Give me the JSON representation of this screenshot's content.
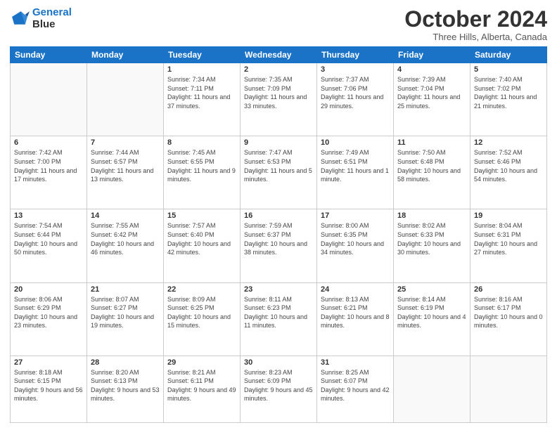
{
  "logo": {
    "line1": "General",
    "line2": "Blue"
  },
  "title": "October 2024",
  "location": "Three Hills, Alberta, Canada",
  "weekdays": [
    "Sunday",
    "Monday",
    "Tuesday",
    "Wednesday",
    "Thursday",
    "Friday",
    "Saturday"
  ],
  "weeks": [
    [
      {
        "day": "",
        "info": ""
      },
      {
        "day": "",
        "info": ""
      },
      {
        "day": "1",
        "info": "Sunrise: 7:34 AM\nSunset: 7:11 PM\nDaylight: 11 hours and 37 minutes."
      },
      {
        "day": "2",
        "info": "Sunrise: 7:35 AM\nSunset: 7:09 PM\nDaylight: 11 hours and 33 minutes."
      },
      {
        "day": "3",
        "info": "Sunrise: 7:37 AM\nSunset: 7:06 PM\nDaylight: 11 hours and 29 minutes."
      },
      {
        "day": "4",
        "info": "Sunrise: 7:39 AM\nSunset: 7:04 PM\nDaylight: 11 hours and 25 minutes."
      },
      {
        "day": "5",
        "info": "Sunrise: 7:40 AM\nSunset: 7:02 PM\nDaylight: 11 hours and 21 minutes."
      }
    ],
    [
      {
        "day": "6",
        "info": "Sunrise: 7:42 AM\nSunset: 7:00 PM\nDaylight: 11 hours and 17 minutes."
      },
      {
        "day": "7",
        "info": "Sunrise: 7:44 AM\nSunset: 6:57 PM\nDaylight: 11 hours and 13 minutes."
      },
      {
        "day": "8",
        "info": "Sunrise: 7:45 AM\nSunset: 6:55 PM\nDaylight: 11 hours and 9 minutes."
      },
      {
        "day": "9",
        "info": "Sunrise: 7:47 AM\nSunset: 6:53 PM\nDaylight: 11 hours and 5 minutes."
      },
      {
        "day": "10",
        "info": "Sunrise: 7:49 AM\nSunset: 6:51 PM\nDaylight: 11 hours and 1 minute."
      },
      {
        "day": "11",
        "info": "Sunrise: 7:50 AM\nSunset: 6:48 PM\nDaylight: 10 hours and 58 minutes."
      },
      {
        "day": "12",
        "info": "Sunrise: 7:52 AM\nSunset: 6:46 PM\nDaylight: 10 hours and 54 minutes."
      }
    ],
    [
      {
        "day": "13",
        "info": "Sunrise: 7:54 AM\nSunset: 6:44 PM\nDaylight: 10 hours and 50 minutes."
      },
      {
        "day": "14",
        "info": "Sunrise: 7:55 AM\nSunset: 6:42 PM\nDaylight: 10 hours and 46 minutes."
      },
      {
        "day": "15",
        "info": "Sunrise: 7:57 AM\nSunset: 6:40 PM\nDaylight: 10 hours and 42 minutes."
      },
      {
        "day": "16",
        "info": "Sunrise: 7:59 AM\nSunset: 6:37 PM\nDaylight: 10 hours and 38 minutes."
      },
      {
        "day": "17",
        "info": "Sunrise: 8:00 AM\nSunset: 6:35 PM\nDaylight: 10 hours and 34 minutes."
      },
      {
        "day": "18",
        "info": "Sunrise: 8:02 AM\nSunset: 6:33 PM\nDaylight: 10 hours and 30 minutes."
      },
      {
        "day": "19",
        "info": "Sunrise: 8:04 AM\nSunset: 6:31 PM\nDaylight: 10 hours and 27 minutes."
      }
    ],
    [
      {
        "day": "20",
        "info": "Sunrise: 8:06 AM\nSunset: 6:29 PM\nDaylight: 10 hours and 23 minutes."
      },
      {
        "day": "21",
        "info": "Sunrise: 8:07 AM\nSunset: 6:27 PM\nDaylight: 10 hours and 19 minutes."
      },
      {
        "day": "22",
        "info": "Sunrise: 8:09 AM\nSunset: 6:25 PM\nDaylight: 10 hours and 15 minutes."
      },
      {
        "day": "23",
        "info": "Sunrise: 8:11 AM\nSunset: 6:23 PM\nDaylight: 10 hours and 11 minutes."
      },
      {
        "day": "24",
        "info": "Sunrise: 8:13 AM\nSunset: 6:21 PM\nDaylight: 10 hours and 8 minutes."
      },
      {
        "day": "25",
        "info": "Sunrise: 8:14 AM\nSunset: 6:19 PM\nDaylight: 10 hours and 4 minutes."
      },
      {
        "day": "26",
        "info": "Sunrise: 8:16 AM\nSunset: 6:17 PM\nDaylight: 10 hours and 0 minutes."
      }
    ],
    [
      {
        "day": "27",
        "info": "Sunrise: 8:18 AM\nSunset: 6:15 PM\nDaylight: 9 hours and 56 minutes."
      },
      {
        "day": "28",
        "info": "Sunrise: 8:20 AM\nSunset: 6:13 PM\nDaylight: 9 hours and 53 minutes."
      },
      {
        "day": "29",
        "info": "Sunrise: 8:21 AM\nSunset: 6:11 PM\nDaylight: 9 hours and 49 minutes."
      },
      {
        "day": "30",
        "info": "Sunrise: 8:23 AM\nSunset: 6:09 PM\nDaylight: 9 hours and 45 minutes."
      },
      {
        "day": "31",
        "info": "Sunrise: 8:25 AM\nSunset: 6:07 PM\nDaylight: 9 hours and 42 minutes."
      },
      {
        "day": "",
        "info": ""
      },
      {
        "day": "",
        "info": ""
      }
    ]
  ]
}
